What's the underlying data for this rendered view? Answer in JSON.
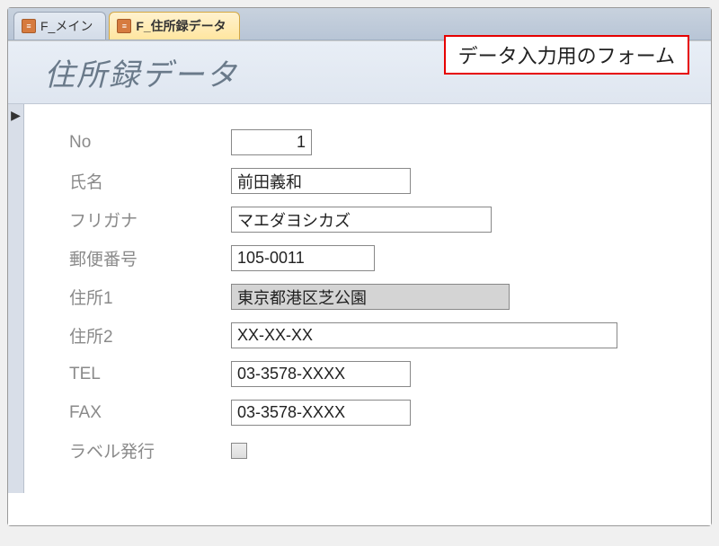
{
  "tabs": {
    "inactive_label": "F_メイン",
    "active_label": "F_住所録データ"
  },
  "annotation": "データ入力用のフォーム",
  "form": {
    "title": "住所録データ",
    "labels": {
      "no": "No",
      "name": "氏名",
      "furigana": "フリガナ",
      "postal": "郵便番号",
      "addr1": "住所1",
      "addr2": "住所2",
      "tel": "TEL",
      "fax": "FAX",
      "label_issue": "ラベル発行"
    },
    "values": {
      "no": "1",
      "name": "前田義和",
      "furigana": "マエダヨシカズ",
      "postal": "105-0011",
      "addr1": "東京都港区芝公園",
      "addr2": "XX-XX-XX",
      "tel": "03-3578-XXXX",
      "fax": "03-3578-XXXX"
    }
  },
  "record_marker": "▶"
}
